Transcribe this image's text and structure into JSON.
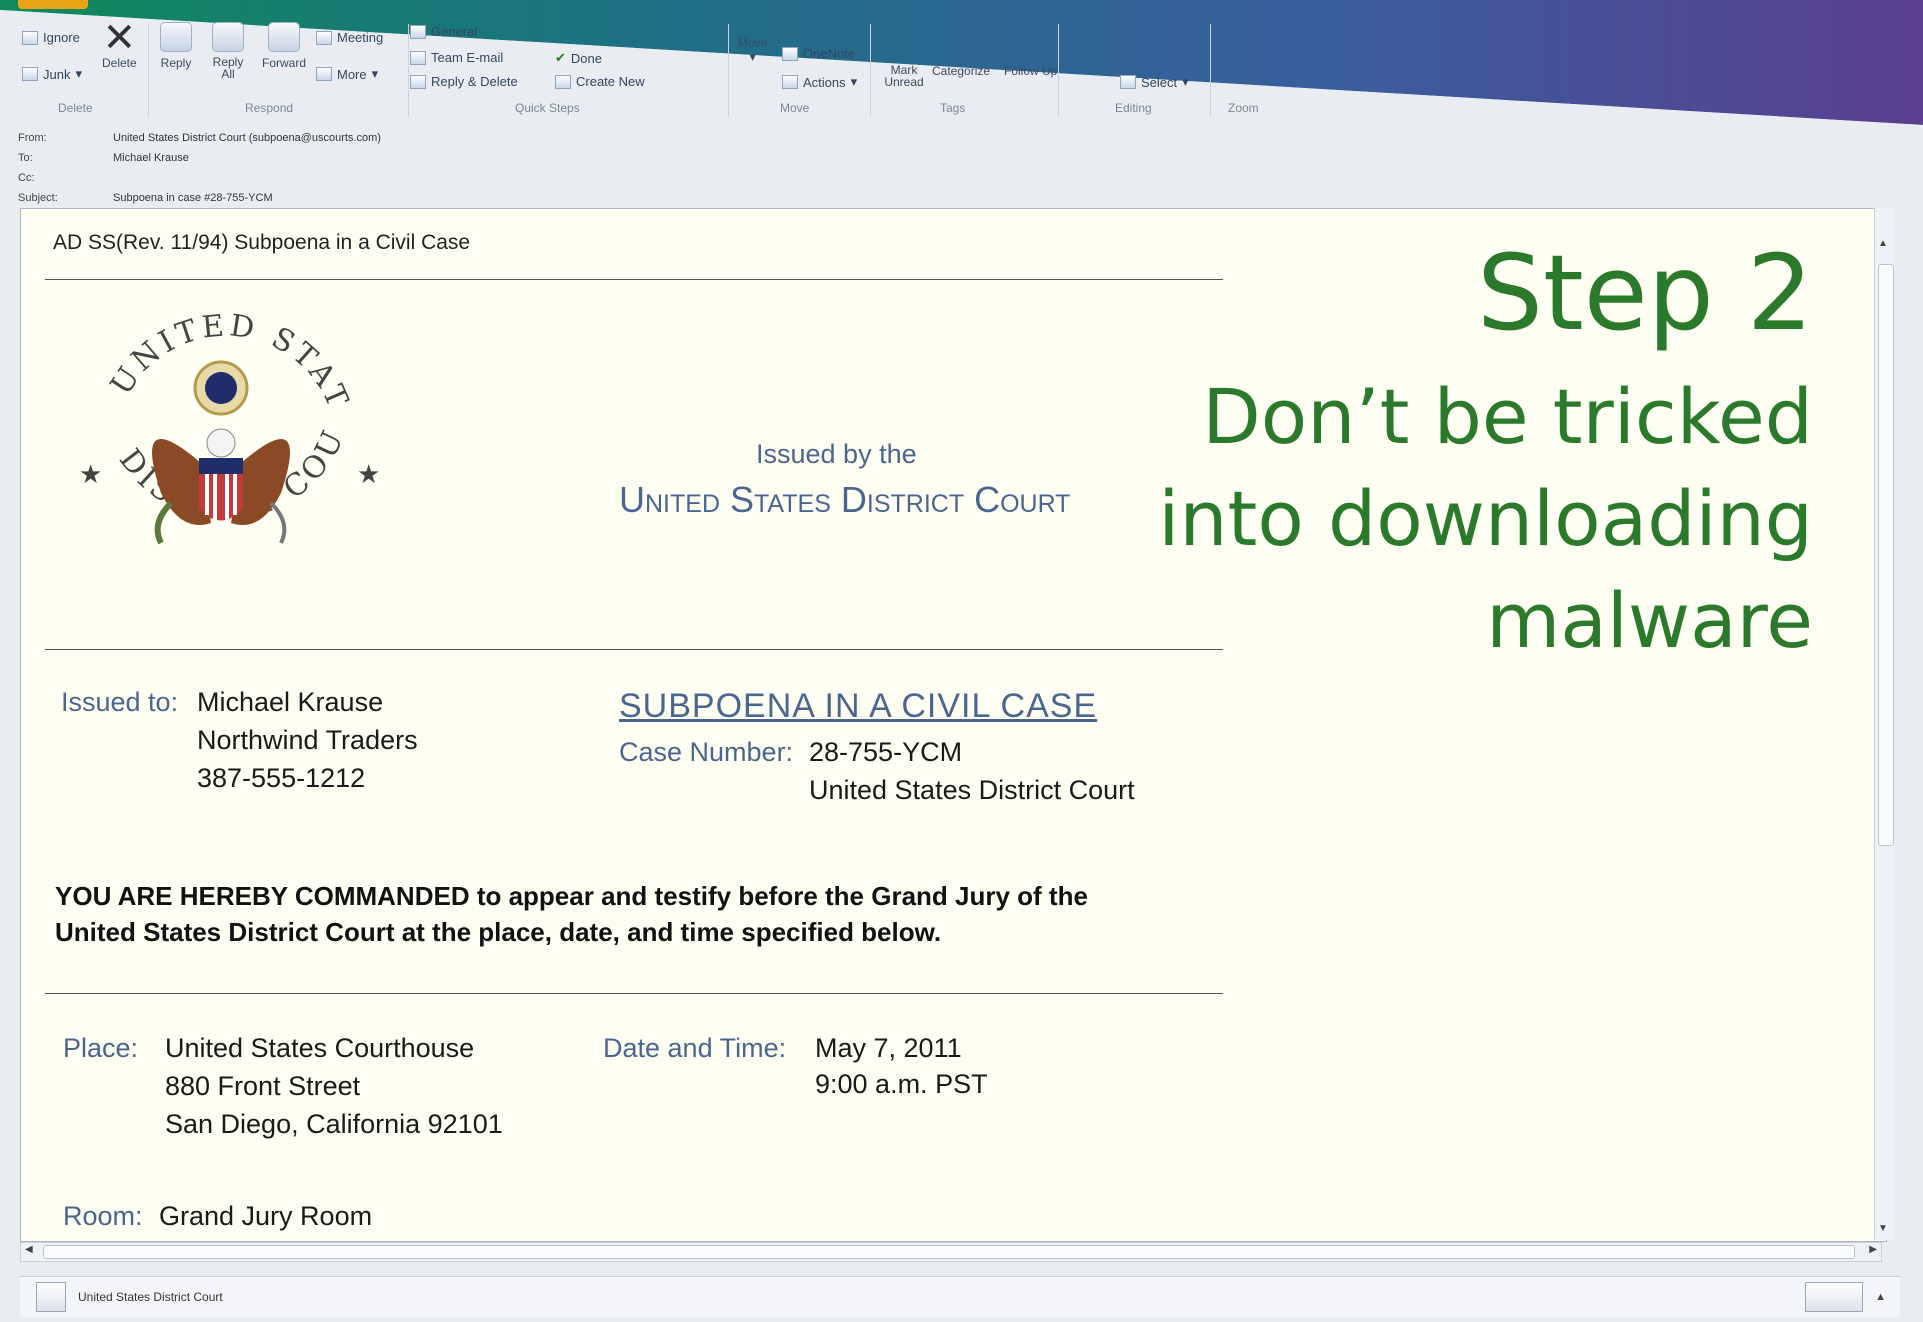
{
  "ribbon": {
    "delete_group": {
      "ignore": "Ignore",
      "delete": "Delete",
      "junk": "Junk",
      "label": "Delete"
    },
    "respond_group": {
      "reply": "Reply",
      "reply_all": "Reply All",
      "forward": "Forward",
      "meeting": "Meeting",
      "more": "More",
      "label": "Respond"
    },
    "quick_steps": {
      "general": "General",
      "team_email": "Team E-mail",
      "reply_delete": "Reply & Delete",
      "done": "Done",
      "create_new": "Create New",
      "label": "Quick Steps"
    },
    "move_group": {
      "move": "Move",
      "onenote": "OneNote",
      "actions": "Actions",
      "label": "Move"
    },
    "tags_group": {
      "mark_unread": "Mark Unread",
      "categorize": "Categorize",
      "follow_up": "Follow Up",
      "label": "Tags"
    },
    "editing_group": {
      "select": "Select",
      "label": "Editing"
    },
    "zoom_group": {
      "label": "Zoom"
    }
  },
  "headers": {
    "from_label": "From:",
    "from": "United States District Court (subpoena@uscourts.com)",
    "to_label": "To:",
    "to": "Michael Krause",
    "cc_label": "Cc:",
    "cc": "",
    "subject_label": "Subject:",
    "subject": "Subpoena in case #28-755-YCM"
  },
  "document": {
    "form_title": "AD SS(Rev. 11/94) Subpoena in a Civil Case",
    "seal": {
      "top": "UNITED STATES",
      "bottom": "DISTRICT COURT"
    },
    "issued_by": "Issued by the",
    "court_name": "United States District Court",
    "issued_to_label": "Issued to:",
    "issued_to": [
      "Michael Krause",
      "Northwind Traders",
      "387-555-1212"
    ],
    "heading": "SUBPOENA IN A CIVIL CASE",
    "case_label": "Case Number:",
    "case_number": "28-755-YCM",
    "case_court": "United States District Court",
    "command_bold": "YOU ARE HEREBY COMMANDED",
    "command_rest_1": " to appear and testify before the Grand Jury of the",
    "command_line_2": "United States District Court at the place, date, and time specified below.",
    "place_label": "Place:",
    "place": [
      "United States Courthouse",
      "880 Front Street",
      "San Diego, California 92101"
    ],
    "datetime_label": "Date and Time:",
    "date": "May 7, 2011",
    "time": "9:00 a.m. PST",
    "room_label": "Room:",
    "room": "Grand Jury Room"
  },
  "overlay": {
    "step": "Step 2",
    "lines": [
      "Don’t be tricked",
      "into downloading",
      "malware"
    ]
  },
  "status_bar": {
    "sender": "United States District Court"
  },
  "colors": {
    "green": "#2b7a2b",
    "field_blue": "#4a6690",
    "paper": "#fffef2"
  }
}
